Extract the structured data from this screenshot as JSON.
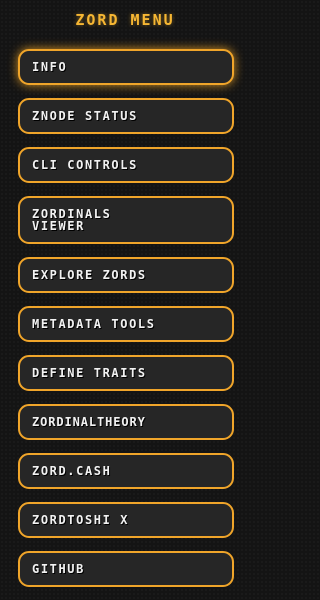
{
  "menu": {
    "title": "ZORD MENU",
    "items": [
      {
        "label": "INFO"
      },
      {
        "label": "ZNODE STATUS"
      },
      {
        "label": "CLI CONTROLS"
      },
      {
        "label": "ZORDINALS VIEWER"
      },
      {
        "label": "EXPLORE ZORDS"
      },
      {
        "label": "METADATA TOOLS"
      },
      {
        "label": "DEFINE TRAITS"
      },
      {
        "label": "ZORDINALTHEORY"
      },
      {
        "label": "ZORD.CASH"
      },
      {
        "label": "ZORDTOSHI X"
      },
      {
        "label": "GITHUB"
      }
    ]
  },
  "colors": {
    "accent": "#f0a52a",
    "title": "#f7b733",
    "button_bg": "#262626",
    "background": "#141414",
    "text": "#f2f2f2"
  }
}
